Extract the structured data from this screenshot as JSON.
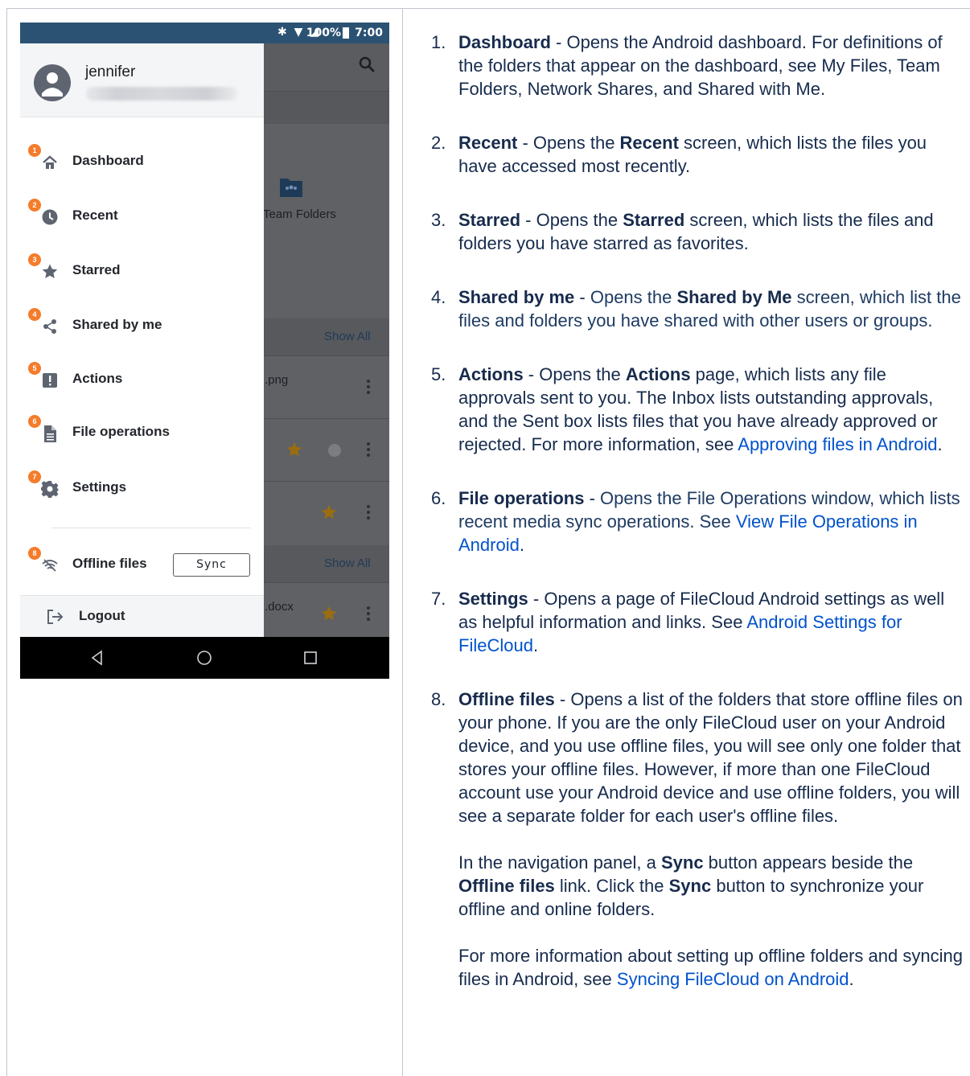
{
  "phone": {
    "status_bar": {
      "icons": "✱ ▼ ◢",
      "battery": "100%",
      "time": "7:00"
    },
    "drawer": {
      "username": "jennifer",
      "menu_items": [
        {
          "number": "1",
          "label": "Dashboard",
          "icon": "home-icon"
        },
        {
          "number": "2",
          "label": "Recent",
          "icon": "clock-icon"
        },
        {
          "number": "3",
          "label": "Starred",
          "icon": "star-icon"
        },
        {
          "number": "4",
          "label": "Shared by me",
          "icon": "share-icon"
        },
        {
          "number": "5",
          "label": "Actions",
          "icon": "alert-icon"
        },
        {
          "number": "6",
          "label": "File operations",
          "icon": "file-icon"
        },
        {
          "number": "7",
          "label": "Settings",
          "icon": "gear-icon"
        },
        {
          "number": "8",
          "label": "Offline files",
          "icon": "wifi-off-icon"
        }
      ],
      "sync_label": "Sync",
      "logout_label": "Logout"
    },
    "background": {
      "folder_label": "Team Folders",
      "show_all_1": "Show All",
      "file_1": ".png",
      "show_all_2": "Show All",
      "file_2": ".docx"
    }
  },
  "doc": {
    "items": [
      {
        "num": "1.",
        "title": "Dashboard",
        "text": " - Opens the Android dashboard. For definitions of the folders that appear on the dashboard, see My Files, Team Folders, Network Shares, and Shared with Me."
      },
      {
        "num": "2.",
        "title": "Recent",
        "t1": " - Opens the ",
        "b1": "Recent",
        "t2": " screen, which lists the files you have accessed most recently."
      },
      {
        "num": "3.",
        "title": "Starred",
        "t1": " - Opens the ",
        "b1": "Starred",
        "t2": " screen, which lists the files and folders you have starred as favorites."
      },
      {
        "num": "4.",
        "title": "Shared by me",
        "t0": " - ",
        "t1": "Opens the ",
        "b1": "Shared by Me",
        "t2": " screen, which list the files and folders you have shared with other users or groups."
      },
      {
        "num": "5.",
        "title": "Actions",
        "t1": " - Opens the ",
        "b1": "Actions",
        "t2": " page, which lists any file approvals sent to you. The Inbox lists outstanding approvals, and the Sent box lists files that you have already approved or rejected. For more information, see ",
        "link": "Approving files in Android",
        "t3": "."
      },
      {
        "num": "6.",
        "title": "File operations",
        "t0": " - ",
        "t1": "Opens the File Operations window, which lists recent media sync operations. See ",
        "link": "View File Operations in Android",
        "t3": "."
      },
      {
        "num": "7.",
        "title": "Settings",
        "t1": " - Opens a page of FileCloud Android settings as well as helpful information and links. See ",
        "link": "Android Settings for FileCloud",
        "t3": "."
      },
      {
        "num": "8.",
        "title": "Offline files",
        "t1": " - Opens a list of the folders that store offline files on your phone. If you are the only FileCloud user on your Android device, and you use offline files, you will see only one folder that stores your offline files. However, if more than one FileCloud account use your Android device and use offline folders, you will see a separate folder for each user's offline files.",
        "p2_t1": "In the navigation panel, a ",
        "p2_b1": "Sync",
        "p2_t2": " button appears beside the ",
        "p2_b2": "Offline files",
        "p2_t3": " link. Click the ",
        "p2_b3": "Sync",
        "p2_t4": " button to synchronize your offline and online folders.",
        "p3_t1": "For more information about setting up offline folders and syncing files in Android, see ",
        "p3_link": "Syncing FileCloud on Android",
        "p3_t2": "."
      }
    ]
  }
}
